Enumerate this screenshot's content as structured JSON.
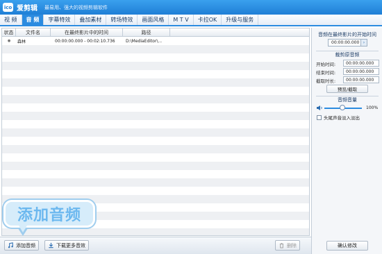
{
  "app": {
    "logo_text": "ico",
    "name": "爱剪辑",
    "slogan": "最易用、强大的视频剪辑软件"
  },
  "menu": [
    {
      "label": "视 频",
      "active": false
    },
    {
      "label": "音 频",
      "active": true
    },
    {
      "label": "字幕特效",
      "active": false
    },
    {
      "label": "叠加素材",
      "active": false
    },
    {
      "label": "转场特效",
      "active": false
    },
    {
      "label": "画面风格",
      "active": false
    },
    {
      "label": "M T V",
      "active": false
    },
    {
      "label": "卡拉OK",
      "active": false
    },
    {
      "label": "升级与服务",
      "active": false
    }
  ],
  "table": {
    "headers": {
      "status": "状态",
      "filename": "文件名",
      "time": "在最终影片中的时间",
      "path": "路径"
    },
    "rows": [
      {
        "status": "●",
        "filename": "森林",
        "time": "00:00:00.000 - 00:02:10.736",
        "path": "D:\\MediaEditor\\..."
      }
    ]
  },
  "bottom": {
    "add_audio": "添加音频",
    "download_more": "下载更多音效",
    "delete": "删除"
  },
  "callout": {
    "text": "添加音频"
  },
  "panel": {
    "start_title": "音频在最终影片的开始时间",
    "start_value": "00:00:00.000",
    "clip_title": "裁剪原音频",
    "start_label": "开始时间:",
    "start_time": "00:00:00.000",
    "end_label": "结束时间:",
    "end_time": "00:00:00.000",
    "duration_label": "截取时长:",
    "duration": "00:00:00.000",
    "preview_btn": "预览/截取",
    "volume_title": "音频音量",
    "volume_pct": "100%",
    "volume_level": 1.0,
    "fade_label": "头尾声音淡入淡出",
    "confirm_btn": "确认修改"
  },
  "colors": {
    "accent": "#2b8be0",
    "titlebar": "#1f7fd6",
    "callout_text": "#6cb8ef"
  }
}
